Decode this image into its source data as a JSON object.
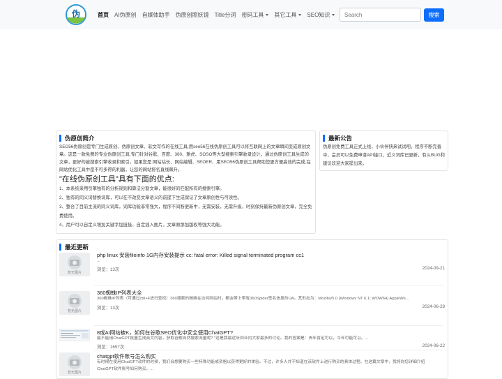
{
  "nav": {
    "logo_text": "伪原创",
    "items": [
      {
        "label": "首页",
        "active": true,
        "dropdown": false
      },
      {
        "label": "AI伪原创",
        "active": false,
        "dropdown": false
      },
      {
        "label": "自媒体助手",
        "active": false,
        "dropdown": false
      },
      {
        "label": "伪原创照妖镜",
        "active": false,
        "dropdown": false
      },
      {
        "label": "Title分词",
        "active": false,
        "dropdown": false
      },
      {
        "label": "密码工具",
        "active": false,
        "dropdown": true
      },
      {
        "label": "其它工具",
        "active": false,
        "dropdown": true
      },
      {
        "label": "SEO知识",
        "active": false,
        "dropdown": true
      }
    ],
    "search_placeholder": "Search",
    "search_button": "搜索"
  },
  "intro": {
    "title": "伪原创简介",
    "paragraph": "SEO56伪原创是专门生成原创、伪原创文章、软文写作的在线工具,用seo56在线伪原创工具可以将互联网上的文章瞬间变成原创文章。这是一款免费的专业伪原创工具,专门针对谷歌、百度、360、雅虎、SOSO等大型搜索引擎收录设计，通过伪原创工具生成的文章，更好的被搜索引擎收录和索引。如果您是 网站站长、网站编辑、SEOER、用SEO56伪原创工具帮助您更方便高效的完成,在网站优化工具中是不可多得的利器，让您的网站排名直线飙升。",
    "heading": "\"在线伪原创工具\"具有下面的优点:",
    "points": [
      "1、本系统采用引擎独有的分析规则和算法分割文章，能很好的匹配所有的搜索引擎。",
      "2、独有的同义词替换词库，可以在不改变文章语义的前提下生成保证了文章原创性与可读性。",
      "3、整合了目前主流的同义词库，词库功能非常强大，程序不间断更新中，无需安装，无需升级，时刻保持最新伪原创文章，完全免费使用。",
      "4、用户可以自定义增加关键字加链接，自定插入图片，文章原那加版权等强大功能。"
    ]
  },
  "notice": {
    "title": "最新公告",
    "text": "伪原创免费工具正式上线，小伙伴快来试试吧。程序不断完善中，会员可以免费申请API接口，近义词库已更新，有么BUG和建议欢迎大家提出来。"
  },
  "recent": {
    "title": "最近更新",
    "thumb_label": "暂无图片",
    "articles": [
      {
        "title": "php linux 安装fileinfo 1G内存安装提示 cc: fatal error: Killed signal terminated program cc1",
        "desc": "...",
        "views": "浏览：13次",
        "date": "2024-09-21",
        "thumb": "placeholder"
      },
      {
        "title": "360蜘蛛IP列表大全",
        "desc": "360蜘蛛IP列表（可通过ctrl+F进行查找）360搜索的蜘蛛在访问网站时，都会带上带有360Spider签名信息的UA。其形态为：Mozilla/5.0 (Windows NT 6.1; WOW64) AppleWe...",
        "views": "浏览：13次",
        "date": "2024-06-28",
        "thumb": "placeholder"
      },
      {
        "title": "8成AI网站被K，如何在谷歌SEO优化中安全使用ChatGPT?",
        "desc": "能不能用ChatGPT批量生成英文内容，获取谷歌自然搜索流量呢? \"这是我最近听到业内大家最多的讨论。我的答案是：去年肯定可以，今年可能可以。...",
        "views": "浏览：1657次",
        "date": "2024-06-22",
        "thumb": "screenshot"
      },
      {
        "title": "chatgpt软件账号怎么购买",
        "desc": "有时候在使用ChatGPT软件的时候，我们会想要购买一些特殊功能或资格以获得更好的体验。不过，许多人并不知道在该软件上进行购买的具体过程。在这篇文章中，我将向您详细介绍ChatGPT软件账号如何购买。...",
        "views": "",
        "date": "",
        "thumb": "placeholder"
      }
    ]
  },
  "colors": {
    "primary": "#0d6efd",
    "navbar_bg": "#f8f9fa"
  }
}
